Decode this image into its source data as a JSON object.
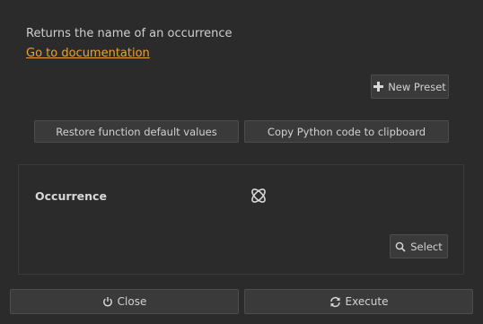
{
  "function": {
    "description": "Returns the name of an occurrence",
    "doc_link": "Go to documentation"
  },
  "toolbar": {
    "new_preset_label": "New Preset",
    "restore_label": "Restore function default values",
    "copy_label": "Copy Python code to clipboard"
  },
  "parameters": [
    {
      "label": "Occurrence",
      "icon": "occurrence-icon",
      "select_label": "Select",
      "select_icon": "search-icon"
    }
  ],
  "footer": {
    "close_label": "Close",
    "close_icon": "power-icon",
    "execute_label": "Execute",
    "execute_icon": "refresh-icon"
  },
  "colors": {
    "background": "#2b2b2b",
    "link": "#e8a33a",
    "button": "#3a3a3a"
  }
}
